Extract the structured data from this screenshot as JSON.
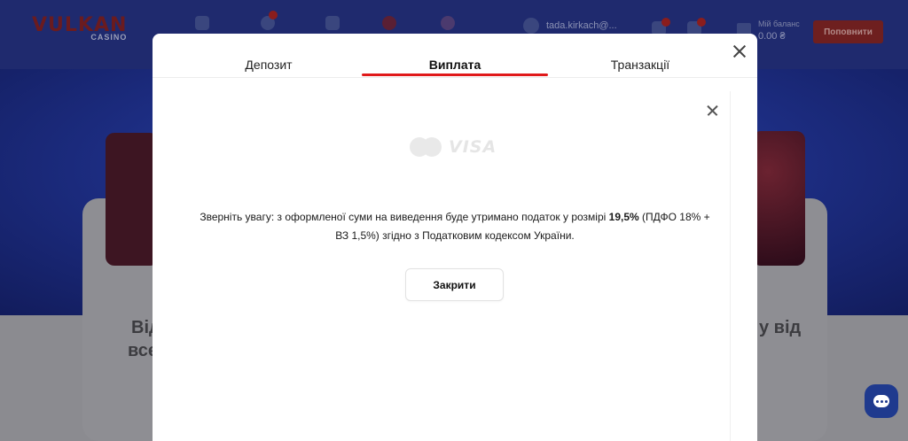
{
  "site": {
    "logo_text": "VULKAN",
    "logo_sub": "CASINO",
    "username": "tada.kirkach@...",
    "balance_label": "Мій баланс",
    "balance_value": "0.00 ₴",
    "topup_label": "Поповнити",
    "bg_text_left_1": "Від",
    "bg_text_left_2": "всє",
    "bg_text_right": "у від"
  },
  "modal": {
    "tabs": [
      {
        "label": "Депозит",
        "active": false
      },
      {
        "label": "Виплата",
        "active": true
      },
      {
        "label": "Транзакції",
        "active": false
      }
    ],
    "payment_logos": [
      "mastercard-icon",
      "visa-icon"
    ],
    "visa_text": "VISA",
    "notice_prefix": "Зверніть увагу: з оформленої суми на виведення буде утримано податок у розмірі ",
    "notice_highlight": "19,5%",
    "notice_suffix": " (ПДФО 18% + ВЗ 1,5%) згідно з Податковим кодексом України.",
    "close_button_label": "Закрити"
  },
  "colors": {
    "accent": "#e0191a",
    "header_bg": "#1f2a6e",
    "chat_button": "#1f3a8e"
  }
}
